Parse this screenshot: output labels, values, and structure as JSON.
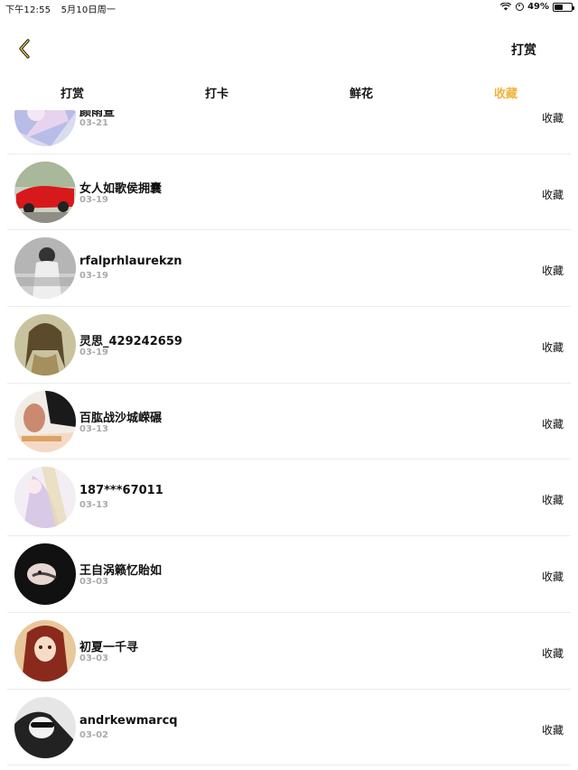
{
  "status_bar": {
    "time": "下午12:55",
    "date": "5月10日周一",
    "battery": "49%",
    "battery_level": 0.49
  },
  "nav": {
    "right_label": "打赏",
    "back_icon": "chevron-left-icon",
    "accent_color": "#f0b43c"
  },
  "tabs": [
    {
      "label": "打赏",
      "active": false
    },
    {
      "label": "打卡",
      "active": false
    },
    {
      "label": "鲜花",
      "active": false
    },
    {
      "label": "收藏",
      "active": true
    }
  ],
  "list": {
    "items": [
      {
        "name": "颜雨萱",
        "date": "03-21",
        "action": "收藏"
      },
      {
        "name": "女人如歌侯拥囊",
        "date": "03-19",
        "action": "收藏"
      },
      {
        "name": "rfalprhlaurekzn",
        "date": "03-19",
        "action": "收藏"
      },
      {
        "name": "灵思_429242659",
        "date": "03-19",
        "action": "收藏"
      },
      {
        "name": "百肱战沙城嵘碾",
        "date": "03-13",
        "action": "收藏"
      },
      {
        "name": "187***67011",
        "date": "03-13",
        "action": "收藏"
      },
      {
        "name": "王自涡籁忆貽如",
        "date": "03-03",
        "action": "收藏"
      },
      {
        "name": "初夏一千寻",
        "date": "03-03",
        "action": "收藏"
      },
      {
        "name": "andrkewmarcq",
        "date": "03-02",
        "action": "收藏"
      }
    ]
  }
}
